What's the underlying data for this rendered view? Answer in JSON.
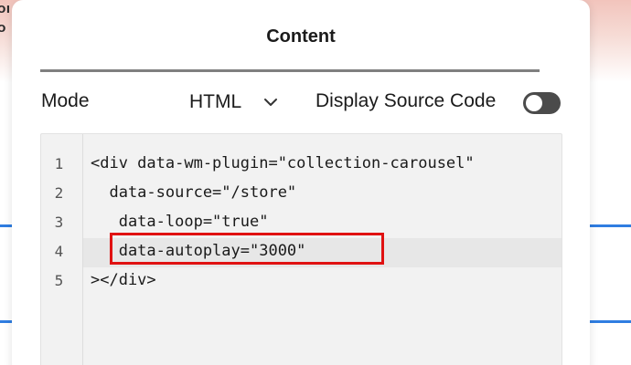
{
  "background": {
    "text_line_1": "OI",
    "text_line_2": "O"
  },
  "panel": {
    "title": "Content"
  },
  "controls": {
    "mode_label": "Mode",
    "mode_value": "HTML",
    "source_label": "Display Source Code",
    "source_toggle_on": false
  },
  "editor": {
    "lines": [
      {
        "number": "1",
        "code": "<div data-wm-plugin=\"collection-carousel\""
      },
      {
        "number": "2",
        "code": "  data-source=\"/store\""
      },
      {
        "number": "3",
        "code": "   data-loop=\"true\""
      },
      {
        "number": "4",
        "code": "   data-autoplay=\"3000\""
      },
      {
        "number": "5",
        "code": "></div>"
      }
    ],
    "highlighted_line": "4"
  },
  "colors": {
    "accent_line": "#2f7de1",
    "highlight_border": "#e01212",
    "toggle_track": "#4b4b4b"
  }
}
